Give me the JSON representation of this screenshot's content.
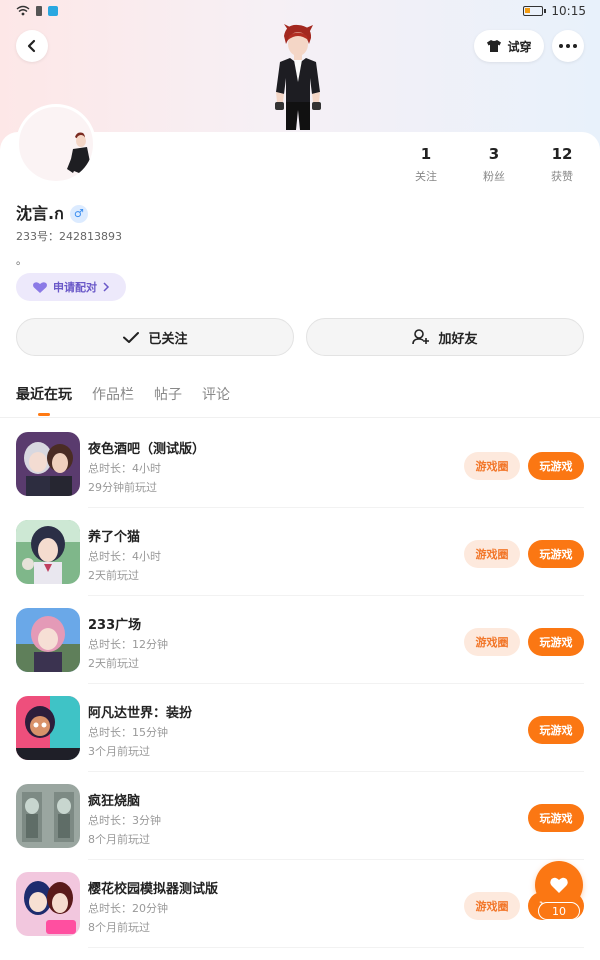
{
  "status_bar": {
    "time": "10:15"
  },
  "header": {
    "try_on_label": "试穿"
  },
  "profile": {
    "username": "沈言.ก",
    "gender_symbol": "♂",
    "uid": "233号：242813893",
    "bio": "。",
    "pair_label": "申请配对",
    "stats": [
      {
        "num": "1",
        "label": "关注"
      },
      {
        "num": "3",
        "label": "粉丝"
      },
      {
        "num": "12",
        "label": "获赞"
      }
    ]
  },
  "actions": {
    "follow_label": "已关注",
    "add_friend_label": "加好友"
  },
  "tabs": [
    {
      "label": "最近在玩",
      "active": true
    },
    {
      "label": "作品栏",
      "active": false
    },
    {
      "label": "帖子",
      "active": false
    },
    {
      "label": "评论",
      "active": false
    }
  ],
  "games": [
    {
      "name": "夜色酒吧（测试版）",
      "duration": "总时长：4小时",
      "last_played": "29分钟前玩过",
      "has_circle": true
    },
    {
      "name": "养了个猫",
      "duration": "总时长：4小时",
      "last_played": "2天前玩过",
      "has_circle": true
    },
    {
      "name": "233广场",
      "duration": "总时长：12分钟",
      "last_played": "2天前玩过",
      "has_circle": true
    },
    {
      "name": "阿凡达世界：装扮",
      "duration": "总时长：15分钟",
      "last_played": "3个月前玩过",
      "has_circle": false
    },
    {
      "name": "疯狂烧脑",
      "duration": "总时长：3分钟",
      "last_played": "8个月前玩过",
      "has_circle": false
    },
    {
      "name": "樱花校园模拟器测试版",
      "duration": "总时长：20分钟",
      "last_played": "8个月前玩过",
      "has_circle": true
    }
  ],
  "game_buttons": {
    "circle_label": "游戏圈",
    "play_label": "玩游戏"
  },
  "like_fab": {
    "count": "10"
  },
  "colors": {
    "accent": "#fb7713",
    "accent_soft": "#fde9dd",
    "pair_bg": "#ede9fb",
    "pair_text": "#6a58c8"
  }
}
